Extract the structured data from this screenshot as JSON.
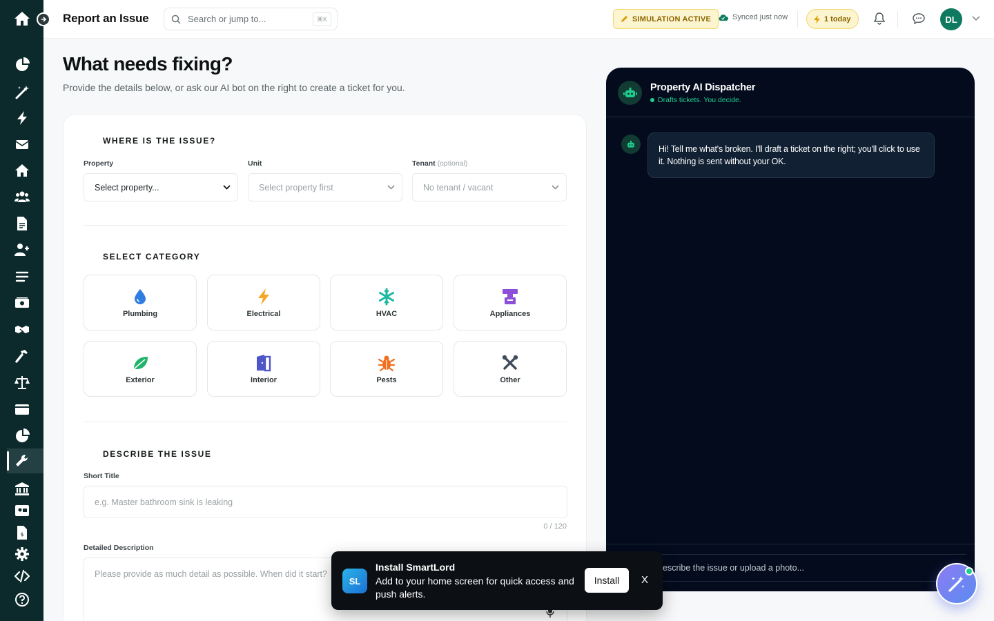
{
  "topbar": {
    "title": "Report an Issue",
    "search_placeholder": "Search or jump to...",
    "search_shortcut": "⌘K",
    "simulation_badge": "SIMULATION ACTIVE",
    "synced_text": "Synced just now",
    "today_badge": "1 today",
    "avatar_initials": "DL"
  },
  "sidebar": {
    "items": [
      {
        "icon": "pie-chart-icon"
      },
      {
        "icon": "magic-wand-icon"
      },
      {
        "icon": "bolt-icon"
      },
      {
        "icon": "envelope-icon"
      },
      {
        "icon": "house-icon"
      },
      {
        "icon": "users-icon"
      },
      {
        "icon": "document-icon"
      },
      {
        "icon": "user-plus-icon"
      },
      {
        "icon": "list-icon"
      },
      {
        "icon": "money-icon"
      },
      {
        "icon": "handshake-icon"
      },
      {
        "icon": "hammer-icon"
      },
      {
        "icon": "scale-icon"
      },
      {
        "icon": "wallet-icon"
      },
      {
        "icon": "pie-chart-icon"
      },
      {
        "icon": "wrench-icon",
        "active": true
      },
      {
        "icon": "bank-icon"
      },
      {
        "icon": "id-card-icon"
      },
      {
        "icon": "invoice-icon"
      },
      {
        "icon": "gear-icon"
      },
      {
        "icon": "code-icon"
      },
      {
        "icon": "help-icon"
      }
    ]
  },
  "page": {
    "title": "What needs fixing?",
    "subtitle": "Provide the details below, or ask our AI bot on the right to create a ticket for you."
  },
  "location": {
    "section_title": "WHERE IS THE ISSUE?",
    "property_label": "Property",
    "property_value": "Select property...",
    "unit_label": "Unit",
    "unit_value": "Select property first",
    "tenant_label": "Tenant",
    "tenant_optional": "(optional)",
    "tenant_value": "No tenant / vacant"
  },
  "category": {
    "section_title": "SELECT CATEGORY",
    "items": [
      {
        "label": "Plumbing",
        "icon": "droplet-icon",
        "color": "#2f7de1"
      },
      {
        "label": "Electrical",
        "icon": "bolt-icon",
        "color": "#f5a623"
      },
      {
        "label": "HVAC",
        "icon": "snowflake-icon",
        "color": "#1bb8a0"
      },
      {
        "label": "Appliances",
        "icon": "appliance-icon",
        "color": "#8b4fd8"
      },
      {
        "label": "Exterior",
        "icon": "leaf-icon",
        "color": "#1fb36b"
      },
      {
        "label": "Interior",
        "icon": "door-icon",
        "color": "#4e56c8"
      },
      {
        "label": "Pests",
        "icon": "bug-icon",
        "color": "#f07020"
      },
      {
        "label": "Other",
        "icon": "tools-icon",
        "color": "#3f4c5c"
      }
    ]
  },
  "describe": {
    "section_title": "DESCRIBE THE ISSUE",
    "short_title_label": "Short Title",
    "short_title_placeholder": "e.g. Master bathroom sink is leaking",
    "counter": "0 / 120",
    "detail_label": "Detailed Description",
    "detail_placeholder": "Please provide as much detail as possible. When did it start?"
  },
  "chat": {
    "title": "Property AI Dispatcher",
    "subtitle": "Drafts tickets. You decide.",
    "message": "Hi! Tell me what's broken. I'll draft a ticket on the right; you'll click to use it. Nothing is sent without your OK.",
    "input_placeholder": "escribe the issue or upload a photo..."
  },
  "toast": {
    "logo": "SL",
    "title": "Install SmartLord",
    "text": "Add to your home screen for quick access and push alerts.",
    "button": "Install",
    "close": "X"
  },
  "colors": {
    "sidebar_bg": "#0c2a2c",
    "chat_bg": "#040b1d",
    "accent_green": "#1fcf8f",
    "avatar_bg": "#0f7a5f"
  }
}
